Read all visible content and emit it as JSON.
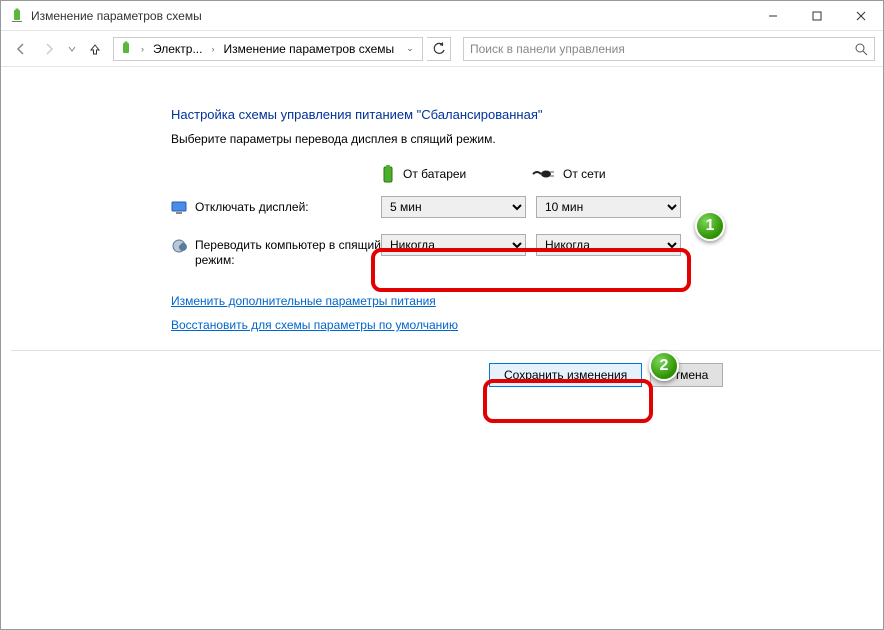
{
  "window": {
    "title": "Изменение параметров схемы"
  },
  "breadcrumb": {
    "item1": "Электр...",
    "item2": "Изменение параметров схемы"
  },
  "search": {
    "placeholder": "Поиск в панели управления"
  },
  "heading": "Настройка схемы управления питанием \"Сбалансированная\"",
  "subheading": "Выберите параметры перевода дисплея в спящий режим.",
  "columns": {
    "battery": "От батареи",
    "ac": "От сети"
  },
  "rows": {
    "display_off": {
      "label": "Отключать дисплей:",
      "battery_value": "5 мин",
      "ac_value": "10 мин"
    },
    "sleep": {
      "label": "Переводить компьютер в спящий режим:",
      "battery_value": "Никогда",
      "ac_value": "Никогда"
    }
  },
  "links": {
    "advanced": "Изменить дополнительные параметры питания",
    "restore": "Восстановить для схемы параметры по умолчанию"
  },
  "buttons": {
    "save": "Сохранить изменения",
    "cancel": "Отмена"
  },
  "callouts": {
    "one": "1",
    "two": "2"
  }
}
